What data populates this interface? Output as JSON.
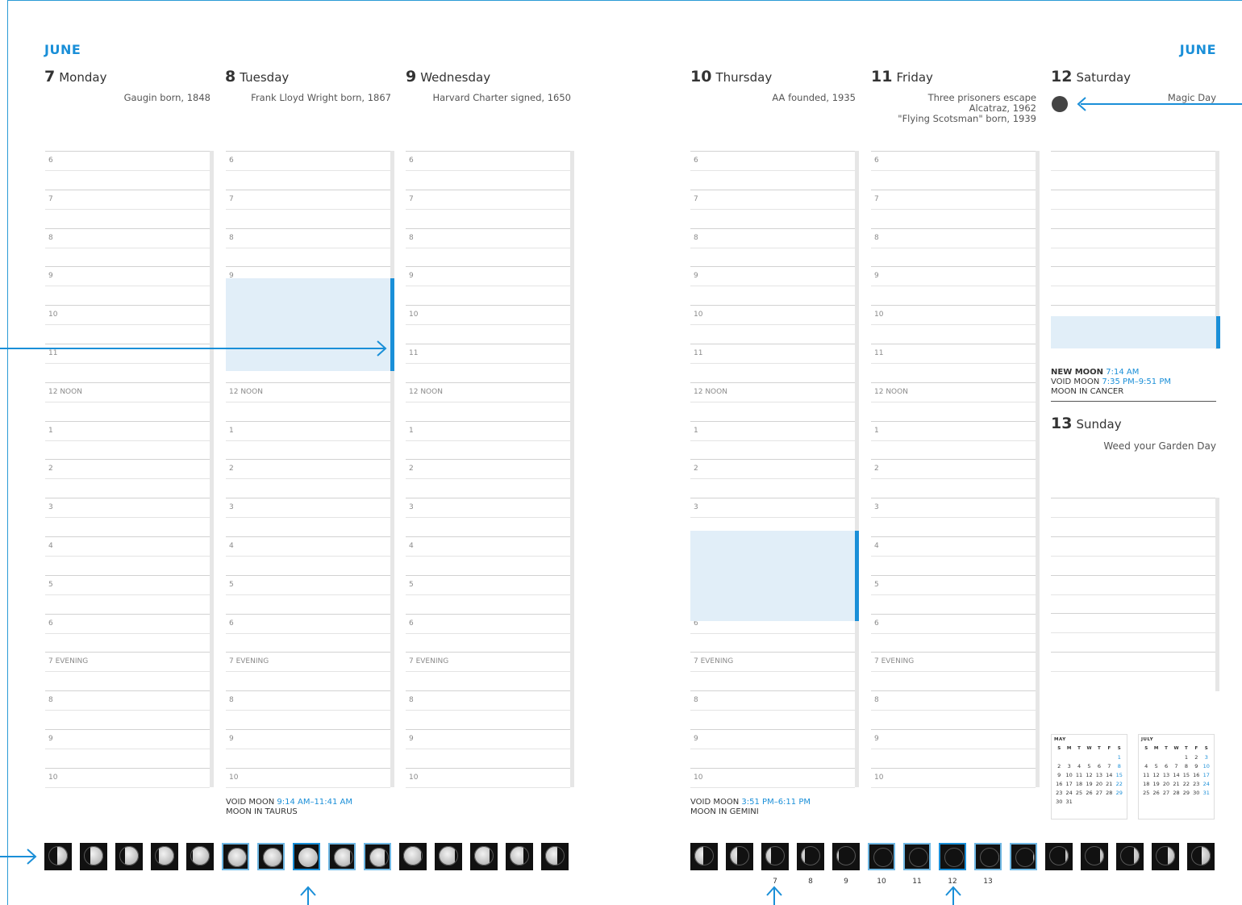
{
  "left": {
    "month": "JUNE",
    "days": [
      {
        "num": "7",
        "name": "Monday",
        "events": [
          "Gaugin born, 1848"
        ]
      },
      {
        "num": "8",
        "name": "Tuesday",
        "events": [
          "Frank Lloyd Wright born, 1867"
        ]
      },
      {
        "num": "9",
        "name": "Wednesday",
        "events": [
          "Harvard Charter signed, 1650"
        ]
      }
    ],
    "moon_note": {
      "void_label": "VOID MOON",
      "void_time": "9:14 AM–11:41 AM",
      "sign": "MOON IN TAURUS"
    }
  },
  "right": {
    "month": "JUNE",
    "days": [
      {
        "num": "10",
        "name": "Thursday",
        "events": [
          "AA founded, 1935"
        ]
      },
      {
        "num": "11",
        "name": "Friday",
        "events": [
          "Three prisoners escape",
          "Alcatraz, 1962",
          "\"Flying Scotsman\" born, 1939"
        ]
      },
      {
        "num": "12",
        "name": "Saturday",
        "events": [
          "Magic Day"
        ]
      }
    ],
    "moon_note": {
      "void_label": "VOID MOON",
      "void_time": "3:51 PM–6:11 PM",
      "sign": "MOON IN GEMINI"
    },
    "saturday_note": {
      "new_label": "NEW MOON",
      "new_time": "7:14 AM",
      "void_label": "VOID MOON",
      "void_time": "7:35 PM–9:51 PM",
      "sign": "MOON IN CANCER"
    },
    "sunday": {
      "num": "13",
      "name": "Sunday",
      "event": "Weed your Garden Day"
    }
  },
  "hours": [
    "6",
    "7",
    "8",
    "9",
    "10",
    "11",
    "12 NOON",
    "1",
    "2",
    "3",
    "4",
    "5",
    "6",
    "7 EVENING",
    "8",
    "9",
    "10"
  ],
  "moon_dates": [
    "7",
    "8",
    "9",
    "10",
    "11",
    "12",
    "13"
  ],
  "mini_calendars": [
    {
      "title": "MAY",
      "header": [
        "S",
        "M",
        "T",
        "W",
        "T",
        "F",
        "S"
      ],
      "rows": [
        [
          "",
          "",
          "",
          "",
          "",
          "",
          "1"
        ],
        [
          "2",
          "3",
          "4",
          "5",
          "6",
          "7",
          "8"
        ],
        [
          "9",
          "10",
          "11",
          "12",
          "13",
          "14",
          "15"
        ],
        [
          "16",
          "17",
          "18",
          "19",
          "20",
          "21",
          "22"
        ],
        [
          "23",
          "24",
          "25",
          "26",
          "27",
          "28",
          "29"
        ],
        [
          "30",
          "31",
          "",
          "",
          "",
          "",
          ""
        ]
      ]
    },
    {
      "title": "JULY",
      "header": [
        "S",
        "M",
        "T",
        "W",
        "T",
        "F",
        "S"
      ],
      "rows": [
        [
          "",
          "",
          "",
          "",
          "1",
          "2",
          "3"
        ],
        [
          "4",
          "5",
          "6",
          "7",
          "8",
          "9",
          "10"
        ],
        [
          "11",
          "12",
          "13",
          "14",
          "15",
          "16",
          "17"
        ],
        [
          "18",
          "19",
          "20",
          "21",
          "22",
          "23",
          "24"
        ],
        [
          "25",
          "26",
          "27",
          "28",
          "29",
          "30",
          "31"
        ]
      ]
    }
  ],
  "colors": {
    "accent": "#1a8fd8",
    "highlight": "#e1eef8"
  }
}
